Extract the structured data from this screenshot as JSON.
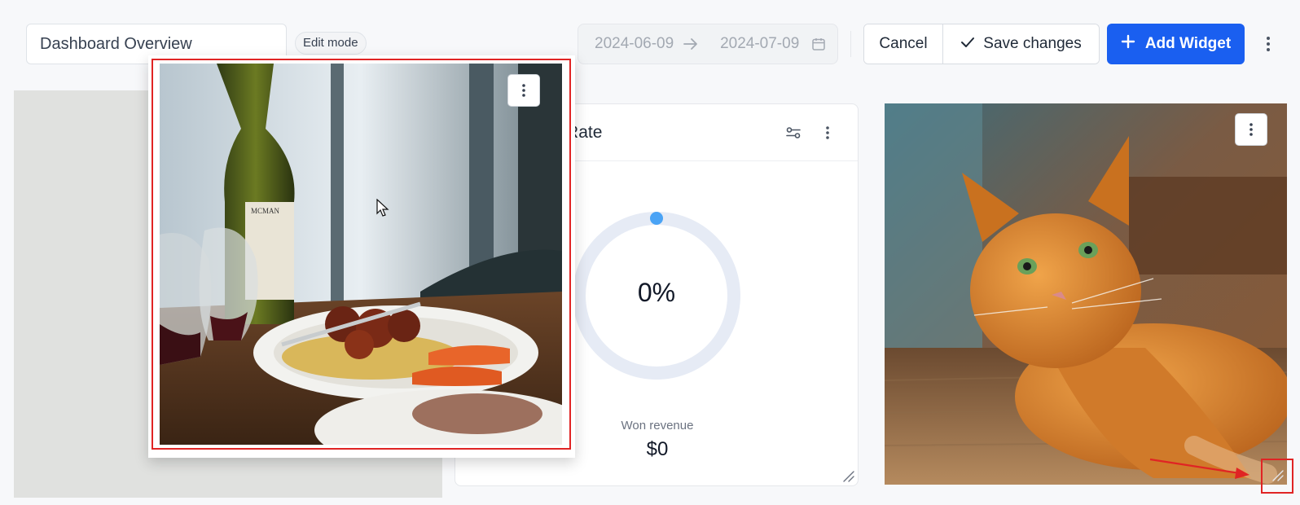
{
  "header": {
    "dashboard_title": "Dashboard Overview",
    "mode_badge": "Edit mode",
    "date_range": {
      "start_placeholder": "2024-06-09",
      "end_placeholder": "2024-07-09"
    },
    "cancel_label": "Cancel",
    "save_label": "Save changes",
    "add_widget_label": "Add Widget"
  },
  "widgets": {
    "dragged_image": {
      "icon": "kebab-menu-icon",
      "subject": "pasta-wine-photo"
    },
    "conversion": {
      "title": "Conversion Rate",
      "gauge_value": "0%",
      "gauge_fraction": 0,
      "metric_label": "Won revenue",
      "metric_value": "$0"
    },
    "cat_image": {
      "icon": "kebab-menu-icon",
      "subject": "cat-photo"
    }
  },
  "colors": {
    "accent": "#1a5ff0",
    "annotation": "#e02424",
    "gauge_track": "#e6ebf5",
    "gauge_dot": "#4aa3f5"
  }
}
